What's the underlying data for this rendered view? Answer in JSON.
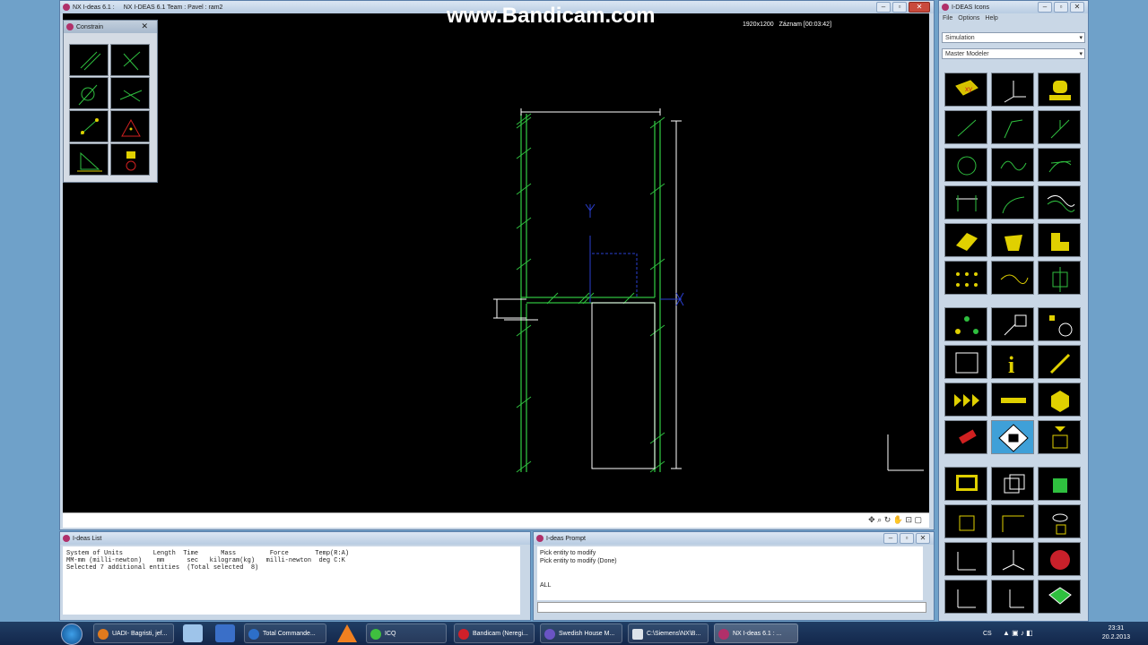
{
  "watermark": "www.Bandicam.com",
  "recording": {
    "resolution": "1920x1200",
    "status": "Záznam [00:03:42]"
  },
  "main_window": {
    "title_app": "NX I-deas 6.1 :",
    "title_team": "NX I-DEAS 6.1 Team : Pavel : ram2"
  },
  "constrain_palette": {
    "title": "Constrain",
    "close": "✕"
  },
  "icons_panel": {
    "title": "I-DEAS Icons",
    "menu": [
      "File",
      "Options",
      "Help"
    ],
    "task_select": "Simulation",
    "application_select": "Master Modeler"
  },
  "list_window": {
    "title": "I-deas List",
    "lines": [
      "System of Units        Length  Time      Mass         Force       Temp(R:A)",
      "",
      "MM-mm (milli-newton)    mm      sec   kilogram(kg)   milli-newton  deg C:K",
      "Selected 7 additional entities  (Total selected  8)"
    ]
  },
  "prompt_window": {
    "title": "I-deas Prompt",
    "lines": [
      "Pick entity to modify",
      "Pick entity to modify (Done)",
      "",
      "",
      "ALL"
    ]
  },
  "taskbar": {
    "items": [
      {
        "label": "UADI- Bagristi, jef...",
        "color": "#e07a1e"
      },
      {
        "label": "Total Commande...",
        "color": "#2d6fc8"
      },
      {
        "label": "ICQ",
        "color": "#3fbf3f"
      },
      {
        "label": "Bandicam (Neregi...",
        "color": "#d0202a"
      },
      {
        "label": "Swedish House M...",
        "color": "#6a54c4"
      },
      {
        "label": "C:\\Siemens\\NX\\B...",
        "color": "#dde3ea"
      },
      {
        "label": "NX I-deas 6.1 : ...",
        "color": "#b0306a"
      }
    ],
    "language": "CS",
    "time": "23:31",
    "date": "20.2.2013"
  },
  "colors": {
    "geometry": "#2fbf3f",
    "dimension": "#ffffff",
    "axis": "#2a3fd0"
  }
}
